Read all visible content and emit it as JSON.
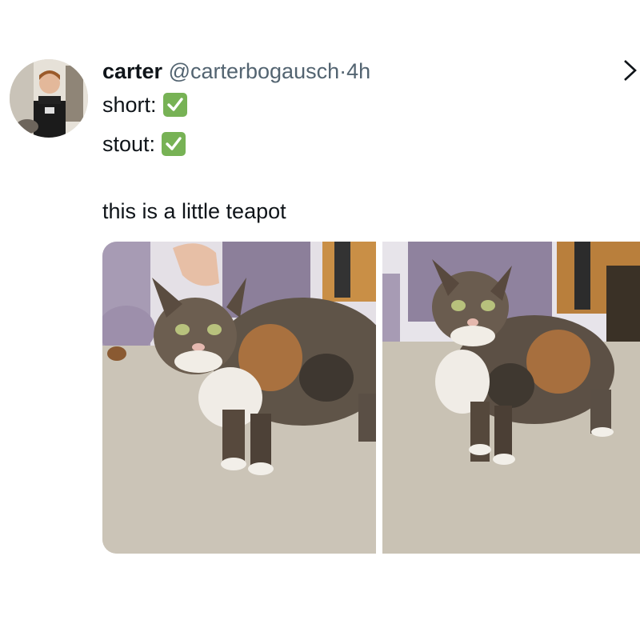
{
  "tweet": {
    "display_name": "carter",
    "handle": "@carterbogausch",
    "separator": "·",
    "time": "4h",
    "lines": [
      {
        "label": "short:",
        "check": "white-check-mark-emoji"
      },
      {
        "label": "stout:",
        "check": "white-check-mark-emoji"
      }
    ],
    "body": "this is a little teapot",
    "more_icon": "chevron-icon"
  },
  "colors": {
    "text": "#0f1419",
    "secondary": "#536471",
    "check_green": "#77b255",
    "carpet": "#cfc9bd"
  }
}
